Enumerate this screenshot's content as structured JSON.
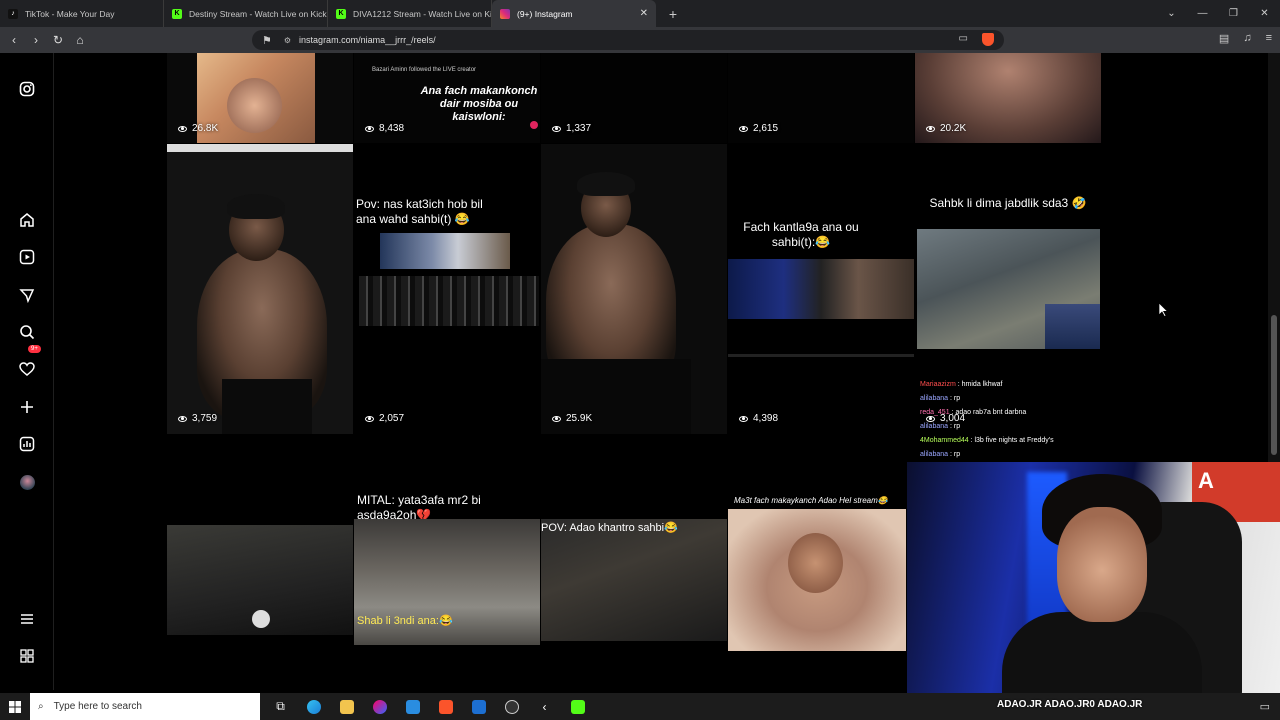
{
  "browser": {
    "tabs": [
      {
        "title": "TikTok - Make Your Day",
        "icon": "tiktok-icon",
        "color": "#000000",
        "active": false
      },
      {
        "title": "Destiny Stream - Watch Live on Kick",
        "icon": "kick-icon",
        "color": "#53fc18",
        "active": false
      },
      {
        "title": "DIVA1212 Stream - Watch Live on Kick",
        "icon": "kick-icon",
        "color": "#53fc18",
        "active": false
      },
      {
        "title": "(9+) Instagram",
        "icon": "instagram-icon",
        "color": "#e1306c",
        "active": true
      }
    ],
    "url": "instagram.com/niama__jrrr_/reels/"
  },
  "sidebar": {
    "notification_badge": "9+"
  },
  "reels": [
    {
      "views": "26.8K",
      "caption": ""
    },
    {
      "views": "8,438",
      "caption": "Ana fach makankonch dair mosiba ou kaiswloni:",
      "overlay": "Bazari Aminn followed the LIVE creator"
    },
    {
      "views": "1,337",
      "caption": ""
    },
    {
      "views": "2,615",
      "caption": ""
    },
    {
      "views": "20.2K",
      "caption": ""
    },
    {
      "views": "3,759",
      "caption": ""
    },
    {
      "views": "2,057",
      "caption": "Pov: nas kat3ich hob bil ana wahd sahbi(t) 😂"
    },
    {
      "views": "25.9K",
      "caption": ""
    },
    {
      "views": "4,398",
      "caption": "Fach kantla9a ana ou sahbi(t):😂"
    },
    {
      "views": "3,004",
      "caption": "Sahbk li dima jabdlik sda3 🤣"
    },
    {
      "views": "",
      "caption": ""
    },
    {
      "views": "",
      "caption": "MITAL: yata3afa mr2 bi asda9a2oh💔",
      "subcaption": "Shab li 3ndi ana:😂"
    },
    {
      "views": "",
      "caption": "POV: Adao khantro sahbi😂"
    },
    {
      "views": "",
      "caption": "Ma3t fach makaykanch Adao Hel stream😂"
    }
  ],
  "stream_chat": [
    {
      "user": "Mariaazizm",
      "text": "hmida lkhwaf"
    },
    {
      "user": "alilabana",
      "text": "rp"
    },
    {
      "user": "reda_451",
      "text": "adao rab7a bnt darbna"
    },
    {
      "user": "alilabana",
      "text": "rp"
    },
    {
      "user": "4Mohammed44",
      "text": "l3b five nights at Freddy's"
    },
    {
      "user": "alilabana",
      "text": "rp"
    }
  ],
  "stream_socials": "ADAO.JR  ADAO.JR0  ADAO.JR",
  "taskbar": {
    "search_placeholder": "Type here to search"
  }
}
